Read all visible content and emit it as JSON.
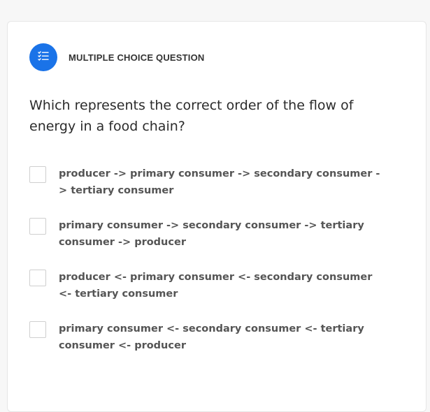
{
  "question_card": {
    "type_label": "MULTIPLE CHOICE QUESTION",
    "type_icon": "list-checks-icon",
    "accent_color": "#1a73e8",
    "question_text": "Which represents the correct order of the flow of energy in a food chain?",
    "options": [
      {
        "label": "producer -> primary consumer -> secondary consumer -> tertiary consumer",
        "checked": false
      },
      {
        "label": "primary consumer -> secondary consumer -> tertiary consumer -> producer",
        "checked": false
      },
      {
        "label": "producer <- primary consumer <- secondary consumer <- tertiary consumer",
        "checked": false
      },
      {
        "label": "primary consumer <- secondary consumer <- tertiary consumer <- producer",
        "checked": false
      }
    ]
  }
}
